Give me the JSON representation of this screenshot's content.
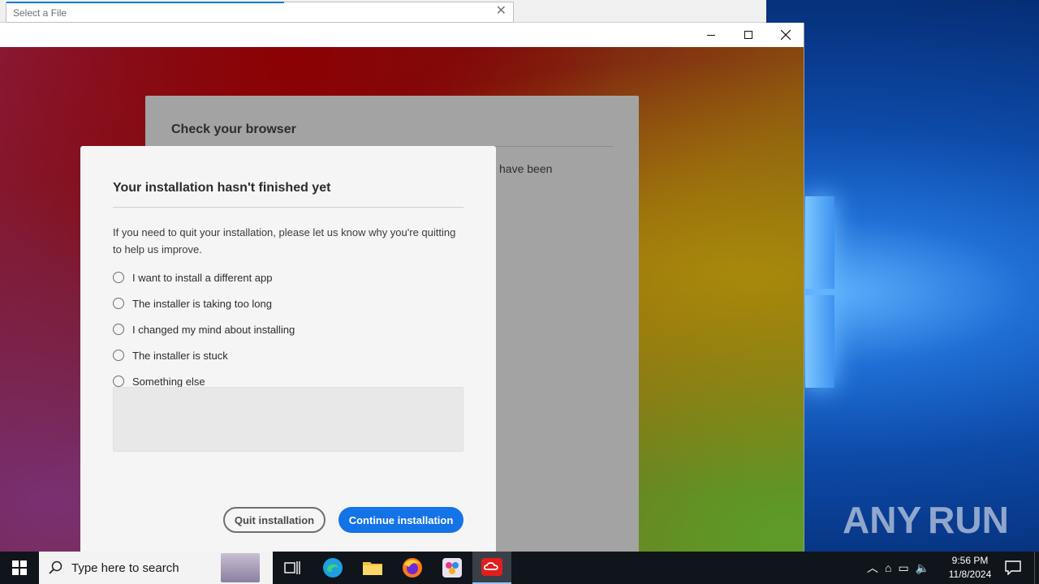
{
  "file_dialog": {
    "label": "Select a File"
  },
  "installer_window": {
    "background_card": {
      "title": "Check your browser",
      "text_fragment": "have been"
    },
    "modal": {
      "title": "Your installation hasn't finished yet",
      "description": "If you need to quit your installation, please let us know why you're quitting to help us improve.",
      "options": [
        {
          "label": "I want to install a different app"
        },
        {
          "label": "The installer is taking too long"
        },
        {
          "label": "I changed my mind about installing"
        },
        {
          "label": "The installer is stuck"
        },
        {
          "label": "Something else"
        }
      ],
      "feedback_value": "",
      "quit_label": "Quit installation",
      "continue_label": "Continue installation",
      "accent_color": "#1473e6"
    }
  },
  "watermark": {
    "left": "ANY",
    "right": "RUN"
  },
  "taskbar": {
    "search_placeholder": "Type here to search",
    "apps": [
      "task-view",
      "edge",
      "file-explorer",
      "firefox",
      "paint",
      "adobe-creative-cloud"
    ],
    "clock_time": "9:56 PM",
    "clock_date": "11/8/2024"
  }
}
